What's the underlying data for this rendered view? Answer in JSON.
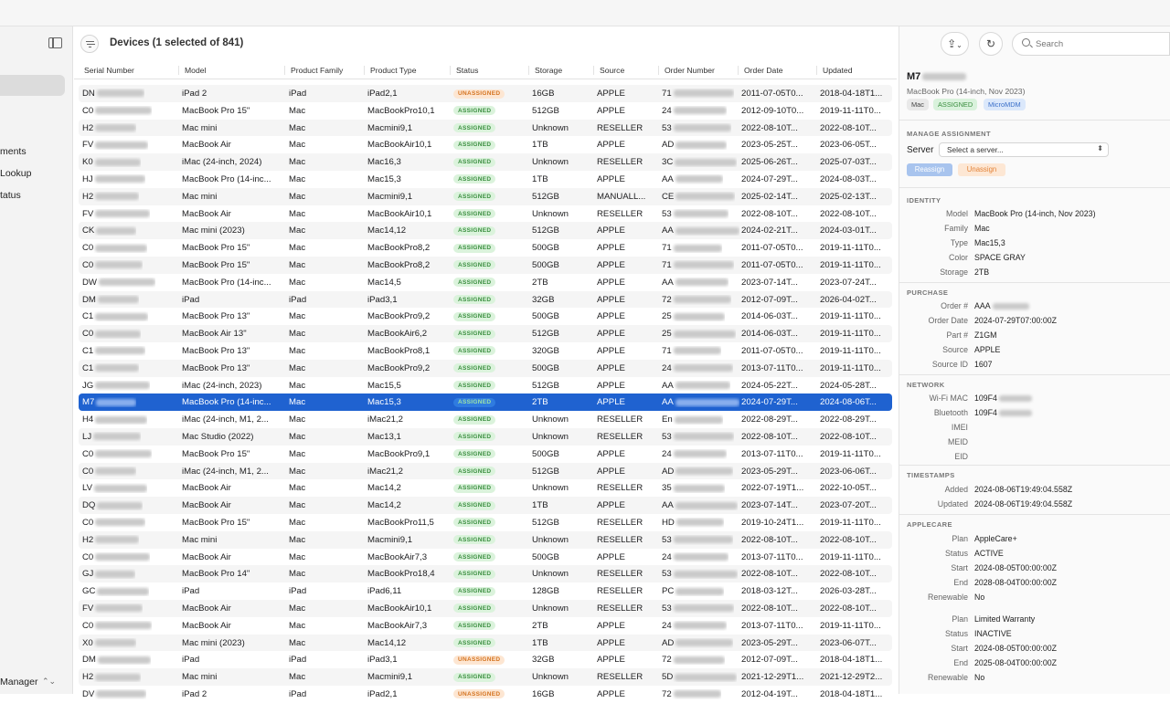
{
  "header": {
    "title": "Devices (1 selected of 841)"
  },
  "sidebar": {
    "items": [
      "ments",
      "Lookup",
      "tatus"
    ],
    "bottom_label": "Manager"
  },
  "table": {
    "columns": [
      "Serial Number",
      "Model",
      "Product Family",
      "Product Type",
      "Status",
      "Storage",
      "Source",
      "Order Number",
      "Order Date",
      "Updated"
    ],
    "rows": [
      {
        "serial": "DN",
        "model": "iPad 2",
        "family": "iPad",
        "type": "iPad2,1",
        "status": "UNASSIGNED",
        "storage": "16GB",
        "source": "APPLE",
        "order": "71",
        "date": "2011-07-05T0...",
        "updated": "2018-04-18T1..."
      },
      {
        "serial": "C0",
        "model": "MacBook Pro 15\"",
        "family": "Mac",
        "type": "MacBookPro10,1",
        "status": "ASSIGNED",
        "storage": "512GB",
        "source": "APPLE",
        "order": "24",
        "date": "2012-09-10T0...",
        "updated": "2019-11-11T0..."
      },
      {
        "serial": "H2",
        "model": "Mac mini",
        "family": "Mac",
        "type": "Macmini9,1",
        "status": "ASSIGNED",
        "storage": "Unknown",
        "source": "RESELLER",
        "order": "53",
        "date": "2022-08-10T...",
        "updated": "2022-08-10T..."
      },
      {
        "serial": "FV",
        "model": "MacBook Air",
        "family": "Mac",
        "type": "MacBookAir10,1",
        "status": "ASSIGNED",
        "storage": "1TB",
        "source": "APPLE",
        "order": "AD",
        "date": "2023-05-25T...",
        "updated": "2023-06-05T..."
      },
      {
        "serial": "K0",
        "model": "iMac (24-inch, 2024)",
        "family": "Mac",
        "type": "Mac16,3",
        "status": "ASSIGNED",
        "storage": "Unknown",
        "source": "RESELLER",
        "order": "3C",
        "date": "2025-06-26T...",
        "updated": "2025-07-03T..."
      },
      {
        "serial": "HJ",
        "model": "MacBook Pro (14-inc...",
        "family": "Mac",
        "type": "Mac15,3",
        "status": "ASSIGNED",
        "storage": "1TB",
        "source": "APPLE",
        "order": "AA",
        "date": "2024-07-29T...",
        "updated": "2024-08-03T..."
      },
      {
        "serial": "H2",
        "model": "Mac mini",
        "family": "Mac",
        "type": "Macmini9,1",
        "status": "ASSIGNED",
        "storage": "512GB",
        "source": "MANUALL...",
        "order": "CE",
        "date": "2025-02-14T...",
        "updated": "2025-02-13T..."
      },
      {
        "serial": "FV",
        "model": "MacBook Air",
        "family": "Mac",
        "type": "MacBookAir10,1",
        "status": "ASSIGNED",
        "storage": "Unknown",
        "source": "RESELLER",
        "order": "53",
        "date": "2022-08-10T...",
        "updated": "2022-08-10T..."
      },
      {
        "serial": "CK",
        "model": "Mac mini (2023)",
        "family": "Mac",
        "type": "Mac14,12",
        "status": "ASSIGNED",
        "storage": "512GB",
        "source": "APPLE",
        "order": "AA",
        "date": "2024-02-21T...",
        "updated": "2024-03-01T..."
      },
      {
        "serial": "C0",
        "model": "MacBook Pro 15\"",
        "family": "Mac",
        "type": "MacBookPro8,2",
        "status": "ASSIGNED",
        "storage": "500GB",
        "source": "APPLE",
        "order": "71",
        "date": "2011-07-05T0...",
        "updated": "2019-11-11T0..."
      },
      {
        "serial": "C0",
        "model": "MacBook Pro 15\"",
        "family": "Mac",
        "type": "MacBookPro8,2",
        "status": "ASSIGNED",
        "storage": "500GB",
        "source": "APPLE",
        "order": "71",
        "date": "2011-07-05T0...",
        "updated": "2019-11-11T0..."
      },
      {
        "serial": "DW",
        "model": "MacBook Pro (14-inc...",
        "family": "Mac",
        "type": "Mac14,5",
        "status": "ASSIGNED",
        "storage": "2TB",
        "source": "APPLE",
        "order": "AA",
        "date": "2023-07-14T...",
        "updated": "2023-07-24T..."
      },
      {
        "serial": "DM",
        "model": "iPad",
        "family": "iPad",
        "type": "iPad3,1",
        "status": "ASSIGNED",
        "storage": "32GB",
        "source": "APPLE",
        "order": "72",
        "date": "2012-07-09T...",
        "updated": "2026-04-02T..."
      },
      {
        "serial": "C1",
        "model": "MacBook Pro 13\"",
        "family": "Mac",
        "type": "MacBookPro9,2",
        "status": "ASSIGNED",
        "storage": "500GB",
        "source": "APPLE",
        "order": "25",
        "date": "2014-06-03T...",
        "updated": "2019-11-11T0..."
      },
      {
        "serial": "C0",
        "model": "MacBook Air 13\"",
        "family": "Mac",
        "type": "MacBookAir6,2",
        "status": "ASSIGNED",
        "storage": "512GB",
        "source": "APPLE",
        "order": "25",
        "date": "2014-06-03T...",
        "updated": "2019-11-11T0..."
      },
      {
        "serial": "C1",
        "model": "MacBook Pro 13\"",
        "family": "Mac",
        "type": "MacBookPro8,1",
        "status": "ASSIGNED",
        "storage": "320GB",
        "source": "APPLE",
        "order": "71",
        "date": "2011-07-05T0...",
        "updated": "2019-11-11T0..."
      },
      {
        "serial": "C1",
        "model": "MacBook Pro 13\"",
        "family": "Mac",
        "type": "MacBookPro9,2",
        "status": "ASSIGNED",
        "storage": "500GB",
        "source": "APPLE",
        "order": "24",
        "date": "2013-07-11T0...",
        "updated": "2019-11-11T0..."
      },
      {
        "serial": "JG",
        "model": "iMac (24-inch, 2023)",
        "family": "Mac",
        "type": "Mac15,5",
        "status": "ASSIGNED",
        "storage": "512GB",
        "source": "APPLE",
        "order": "AA",
        "date": "2024-05-22T...",
        "updated": "2024-05-28T..."
      },
      {
        "serial": "M7",
        "model": "MacBook Pro (14-inc...",
        "family": "Mac",
        "type": "Mac15,3",
        "status": "ASSIGNED",
        "storage": "2TB",
        "source": "APPLE",
        "order": "AA",
        "date": "2024-07-29T...",
        "updated": "2024-08-06T...",
        "selected": true
      },
      {
        "serial": "H4",
        "model": "iMac (24-inch, M1, 2...",
        "family": "Mac",
        "type": "iMac21,2",
        "status": "ASSIGNED",
        "storage": "Unknown",
        "source": "RESELLER",
        "order": "En",
        "date": "2022-08-29T...",
        "updated": "2022-08-29T..."
      },
      {
        "serial": "LJ",
        "model": "Mac Studio (2022)",
        "family": "Mac",
        "type": "Mac13,1",
        "status": "ASSIGNED",
        "storage": "Unknown",
        "source": "RESELLER",
        "order": "53",
        "date": "2022-08-10T...",
        "updated": "2022-08-10T..."
      },
      {
        "serial": "C0",
        "model": "MacBook Pro 15\"",
        "family": "Mac",
        "type": "MacBookPro9,1",
        "status": "ASSIGNED",
        "storage": "500GB",
        "source": "APPLE",
        "order": "24",
        "date": "2013-07-11T0...",
        "updated": "2019-11-11T0..."
      },
      {
        "serial": "C0",
        "model": "iMac (24-inch, M1, 2...",
        "family": "Mac",
        "type": "iMac21,2",
        "status": "ASSIGNED",
        "storage": "512GB",
        "source": "APPLE",
        "order": "AD",
        "date": "2023-05-29T...",
        "updated": "2023-06-06T..."
      },
      {
        "serial": "LV",
        "model": "MacBook Air",
        "family": "Mac",
        "type": "Mac14,2",
        "status": "ASSIGNED",
        "storage": "Unknown",
        "source": "RESELLER",
        "order": "35",
        "date": "2022-07-19T1...",
        "updated": "2022-10-05T..."
      },
      {
        "serial": "DQ",
        "model": "MacBook Air",
        "family": "Mac",
        "type": "Mac14,2",
        "status": "ASSIGNED",
        "storage": "1TB",
        "source": "APPLE",
        "order": "AA",
        "date": "2023-07-14T...",
        "updated": "2023-07-20T..."
      },
      {
        "serial": "C0",
        "model": "MacBook Pro 15\"",
        "family": "Mac",
        "type": "MacBookPro11,5",
        "status": "ASSIGNED",
        "storage": "512GB",
        "source": "RESELLER",
        "order": "HD",
        "date": "2019-10-24T1...",
        "updated": "2019-11-11T0..."
      },
      {
        "serial": "H2",
        "model": "Mac mini",
        "family": "Mac",
        "type": "Macmini9,1",
        "status": "ASSIGNED",
        "storage": "Unknown",
        "source": "RESELLER",
        "order": "53",
        "date": "2022-08-10T...",
        "updated": "2022-08-10T..."
      },
      {
        "serial": "C0",
        "model": "MacBook Air",
        "family": "Mac",
        "type": "MacBookAir7,3",
        "status": "ASSIGNED",
        "storage": "500GB",
        "source": "APPLE",
        "order": "24",
        "date": "2013-07-11T0...",
        "updated": "2019-11-11T0..."
      },
      {
        "serial": "GJ",
        "model": "MacBook Pro 14\"",
        "family": "Mac",
        "type": "MacBookPro18,4",
        "status": "ASSIGNED",
        "storage": "Unknown",
        "source": "RESELLER",
        "order": "53",
        "date": "2022-08-10T...",
        "updated": "2022-08-10T..."
      },
      {
        "serial": "GC",
        "model": "iPad",
        "family": "iPad",
        "type": "iPad6,11",
        "status": "ASSIGNED",
        "storage": "128GB",
        "source": "RESELLER",
        "order": "PC",
        "date": "2018-03-12T...",
        "updated": "2026-03-28T..."
      },
      {
        "serial": "FV",
        "model": "MacBook Air",
        "family": "Mac",
        "type": "MacBookAir10,1",
        "status": "ASSIGNED",
        "storage": "Unknown",
        "source": "RESELLER",
        "order": "53",
        "date": "2022-08-10T...",
        "updated": "2022-08-10T..."
      },
      {
        "serial": "C0",
        "model": "MacBook Air",
        "family": "Mac",
        "type": "MacBookAir7,3",
        "status": "ASSIGNED",
        "storage": "2TB",
        "source": "APPLE",
        "order": "24",
        "date": "2013-07-11T0...",
        "updated": "2019-11-11T0..."
      },
      {
        "serial": "X0",
        "model": "Mac mini (2023)",
        "family": "Mac",
        "type": "Mac14,12",
        "status": "ASSIGNED",
        "storage": "1TB",
        "source": "APPLE",
        "order": "AD",
        "date": "2023-05-29T...",
        "updated": "2023-06-07T..."
      },
      {
        "serial": "DM",
        "model": "iPad",
        "family": "iPad",
        "type": "iPad3,1",
        "status": "UNASSIGNED",
        "storage": "32GB",
        "source": "APPLE",
        "order": "72",
        "date": "2012-07-09T...",
        "updated": "2018-04-18T1..."
      },
      {
        "serial": "H2",
        "model": "Mac mini",
        "family": "Mac",
        "type": "Macmini9,1",
        "status": "ASSIGNED",
        "storage": "Unknown",
        "source": "RESELLER",
        "order": "5D",
        "date": "2021-12-29T1...",
        "updated": "2021-12-29T2..."
      },
      {
        "serial": "DV",
        "model": "iPad 2",
        "family": "iPad",
        "type": "iPad2,1",
        "status": "UNASSIGNED",
        "storage": "16GB",
        "source": "APPLE",
        "order": "72",
        "date": "2012-04-19T...",
        "updated": "2018-04-18T1..."
      }
    ]
  },
  "toolbar": {
    "share_icon": "share-icon",
    "refresh_icon": "refresh-icon"
  },
  "search": {
    "placeholder": "Search"
  },
  "detail": {
    "title": "M7",
    "subtitle": "MacBook Pro (14-inch, Nov 2023)",
    "tags": [
      "Mac",
      "ASSIGNED",
      "MicroMDM"
    ],
    "manage_assignment": {
      "heading": "MANAGE ASSIGNMENT",
      "server_label": "Server",
      "server_placeholder": "Select a server...",
      "reassign": "Reassign",
      "unassign": "Unassign"
    },
    "identity": {
      "heading": "IDENTITY",
      "rows": [
        {
          "k": "Model",
          "v": "MacBook Pro (14-inch, Nov 2023)"
        },
        {
          "k": "Family",
          "v": "Mac"
        },
        {
          "k": "Type",
          "v": "Mac15,3"
        },
        {
          "k": "Color",
          "v": "SPACE GRAY"
        },
        {
          "k": "Storage",
          "v": "2TB"
        }
      ]
    },
    "purchase": {
      "heading": "PURCHASE",
      "rows": [
        {
          "k": "Order #",
          "v": "AAA"
        },
        {
          "k": "Order Date",
          "v": "2024-07-29T07:00:00Z"
        },
        {
          "k": "Part #",
          "v": "Z1GM"
        },
        {
          "k": "Source",
          "v": "APPLE"
        },
        {
          "k": "Source ID",
          "v": "1607"
        }
      ]
    },
    "network": {
      "heading": "NETWORK",
      "rows": [
        {
          "k": "Wi-Fi MAC",
          "v": "109F4"
        },
        {
          "k": "Bluetooth",
          "v": "109F4"
        },
        {
          "k": "IMEI",
          "v": ""
        },
        {
          "k": "MEID",
          "v": ""
        },
        {
          "k": "EID",
          "v": ""
        }
      ]
    },
    "timestamps": {
      "heading": "TIMESTAMPS",
      "rows": [
        {
          "k": "Added",
          "v": "2024-08-06T19:49:04.558Z"
        },
        {
          "k": "Updated",
          "v": "2024-08-06T19:49:04.558Z"
        }
      ]
    },
    "applecare": {
      "heading": "APPLECARE",
      "rows": [
        {
          "k": "Plan",
          "v": "AppleCare+"
        },
        {
          "k": "Status",
          "v": "ACTIVE"
        },
        {
          "k": "Start",
          "v": "2024-08-05T00:00:00Z"
        },
        {
          "k": "End",
          "v": "2028-08-04T00:00:00Z"
        },
        {
          "k": "Renewable",
          "v": "No"
        },
        {
          "k": "Plan",
          "v": "Limited Warranty"
        },
        {
          "k": "Status",
          "v": "INACTIVE"
        },
        {
          "k": "Start",
          "v": "2024-08-05T00:00:00Z"
        },
        {
          "k": "End",
          "v": "2025-08-04T00:00:00Z"
        },
        {
          "k": "Renewable",
          "v": "No"
        }
      ]
    }
  }
}
